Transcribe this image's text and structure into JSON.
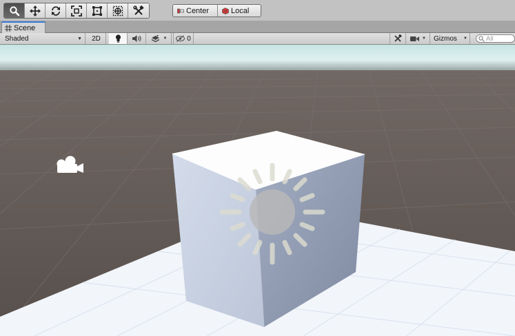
{
  "toolbar": {
    "tools": [
      {
        "name": "View Tool",
        "icon": "magnifier-icon",
        "active": true
      },
      {
        "name": "Move Tool",
        "icon": "move-arrows-icon",
        "active": false
      },
      {
        "name": "Rotate Tool",
        "icon": "rotate-icon",
        "active": false
      },
      {
        "name": "Scale Tool",
        "icon": "scale-icon",
        "active": false
      },
      {
        "name": "Rect Tool",
        "icon": "rect-icon",
        "active": false
      },
      {
        "name": "Transform Tool",
        "icon": "transform-icon",
        "active": false
      },
      {
        "name": "Custom Tool",
        "icon": "custom-tools-icon",
        "active": false
      }
    ],
    "pivot_mode_label": "Center",
    "pivot_rotation_label": "Local"
  },
  "tabs": [
    {
      "label": "Scene",
      "icon": "grid-hash-icon",
      "active": true
    }
  ],
  "scene_toolbar": {
    "draw_mode": "Shaded",
    "mode_2d": "2D",
    "hidden_objects_count": "0",
    "gizmos_label": "Gizmos",
    "search_placeholder": "All"
  },
  "viewport": {
    "objects": [
      "camera-gizmo-icon",
      "cube",
      "directional-light-gizmo-icon"
    ],
    "colors": {
      "sky": "#c6e3e3",
      "ground": "#5e5753",
      "floor": "#f3f6fb",
      "cube_top": "#fdfdfe",
      "cube_left": "#c7d0e0",
      "cube_right": "#8f9bb2"
    }
  }
}
